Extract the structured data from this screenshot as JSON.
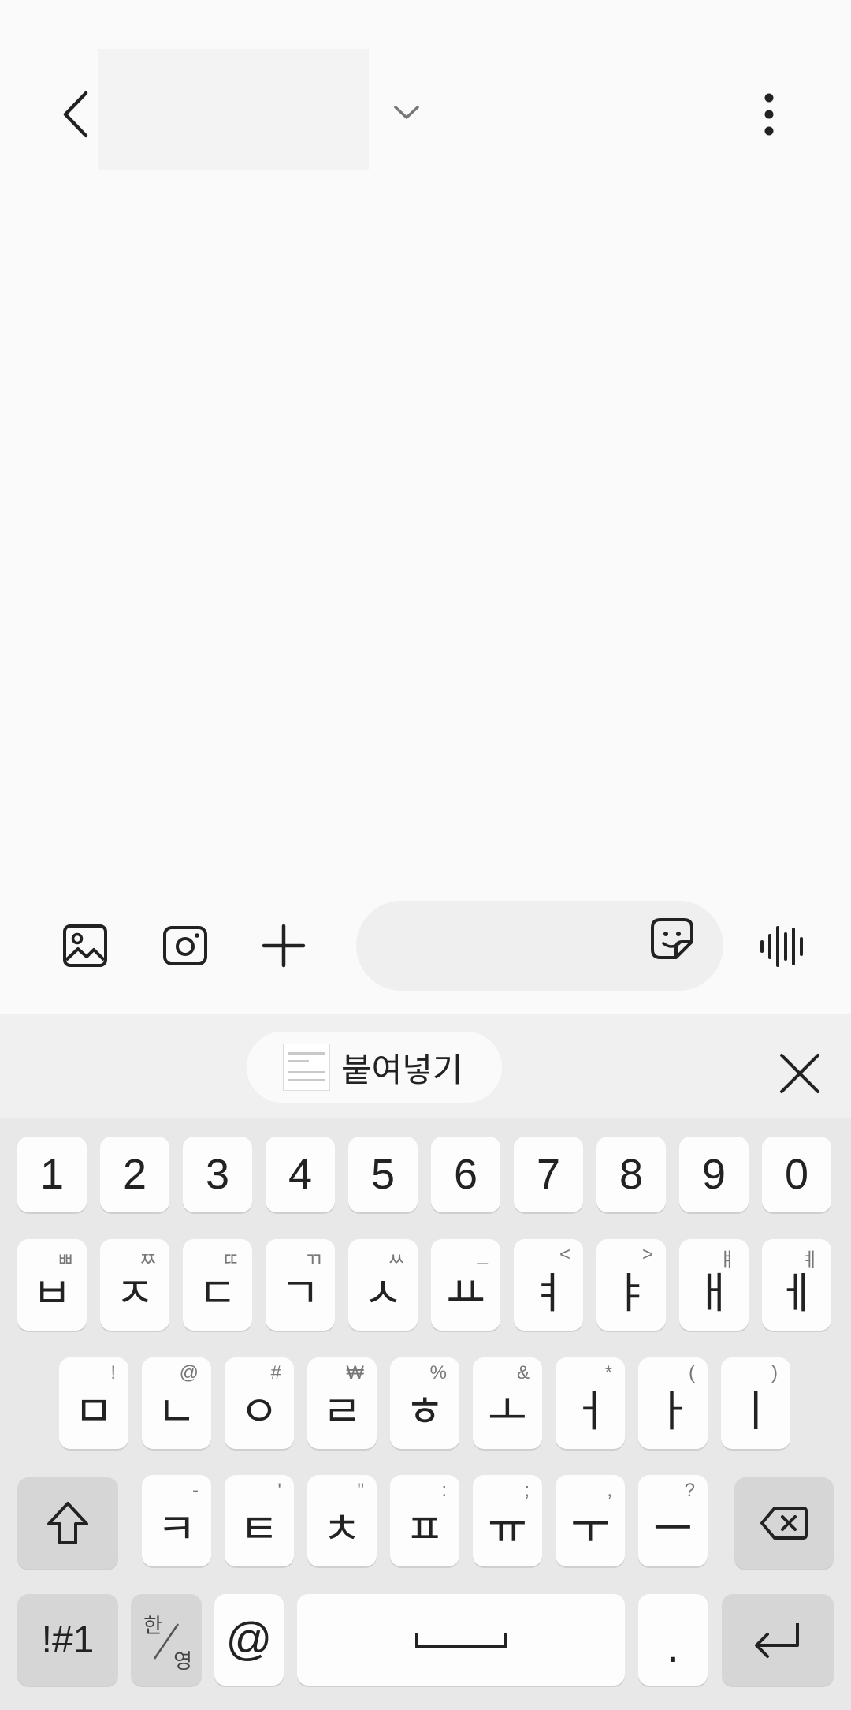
{
  "header": {
    "title": "",
    "back_icon": "chevron-left-icon",
    "dropdown_icon": "chevron-down-icon",
    "more_icon": "more-vert-icon"
  },
  "compose": {
    "gallery_icon": "image-icon",
    "camera_icon": "camera-icon",
    "add_icon": "plus-icon",
    "input_value": "",
    "input_placeholder": "",
    "sticker_icon": "sticker-icon",
    "voice_icon": "voice-wave-icon"
  },
  "keyboard": {
    "paste_label": "붙여넣기",
    "close_icon": "close-icon",
    "number_row": [
      "1",
      "2",
      "3",
      "4",
      "5",
      "6",
      "7",
      "8",
      "9",
      "0"
    ],
    "row1": [
      {
        "main": "ㅂ",
        "sub": "ㅃ"
      },
      {
        "main": "ㅈ",
        "sub": "ㅉ"
      },
      {
        "main": "ㄷ",
        "sub": "ㄸ"
      },
      {
        "main": "ㄱ",
        "sub": "ㄲ"
      },
      {
        "main": "ㅅ",
        "sub": "ㅆ"
      },
      {
        "main": "ㅛ",
        "sub": "_"
      },
      {
        "main": "ㅕ",
        "sub": "<"
      },
      {
        "main": "ㅑ",
        "sub": ">"
      },
      {
        "main": "ㅐ",
        "sub": "ㅒ"
      },
      {
        "main": "ㅔ",
        "sub": "ㅖ"
      }
    ],
    "row2": [
      {
        "main": "ㅁ",
        "sub": "!"
      },
      {
        "main": "ㄴ",
        "sub": "@"
      },
      {
        "main": "ㅇ",
        "sub": "#"
      },
      {
        "main": "ㄹ",
        "sub": "₩"
      },
      {
        "main": "ㅎ",
        "sub": "%"
      },
      {
        "main": "ㅗ",
        "sub": "&"
      },
      {
        "main": "ㅓ",
        "sub": "*"
      },
      {
        "main": "ㅏ",
        "sub": "("
      },
      {
        "main": "ㅣ",
        "sub": ")"
      }
    ],
    "row3": [
      {
        "main": "ㅋ",
        "sub": "-"
      },
      {
        "main": "ㅌ",
        "sub": "'"
      },
      {
        "main": "ㅊ",
        "sub": "\""
      },
      {
        "main": "ㅍ",
        "sub": ":"
      },
      {
        "main": "ㅠ",
        "sub": ";"
      },
      {
        "main": "ㅜ",
        "sub": ","
      },
      {
        "main": "ㅡ",
        "sub": "?"
      }
    ],
    "shift_icon": "shift-icon",
    "backspace_icon": "backspace-icon",
    "symbols_label": "!#1",
    "lang_top": "한",
    "lang_bottom": "영",
    "at_label": "@",
    "space_icon": "space-bar-icon",
    "period_label": ".",
    "enter_icon": "enter-icon"
  }
}
